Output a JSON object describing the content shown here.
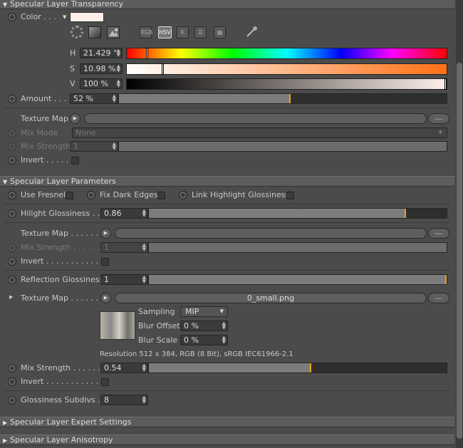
{
  "sections": {
    "transparency": "Specular Layer Transparency",
    "parameters": "Specular Layer Parameters",
    "expert": "Specular Layer Expert Settings",
    "anisotropy": "Specular Layer Anisotropy"
  },
  "transparency": {
    "color_label": "Color . . .",
    "color_swatch": "#fff0ea",
    "mode_buttons": [
      "RGB",
      "HSV",
      "K"
    ],
    "h_label": "H",
    "h_value": "21.429 °",
    "s_label": "S",
    "s_value": "10.98 %",
    "v_label": "V",
    "v_value": "100 %",
    "amount_label": "Amount . . . .",
    "amount_value": "52 %",
    "amount_fraction": 0.52,
    "texture_map_label": "Texture Map",
    "more_button": "...",
    "mix_mode_label": "Mix Mode . .",
    "mix_mode_value": "None",
    "mix_strength_label": "Mix Strength",
    "mix_strength_value": "1",
    "invert_label": "Invert . . . . . ."
  },
  "parameters": {
    "use_fresnel": "Use Fresnel",
    "fix_dark_edges": "Fix Dark Edges",
    "link_highlight": "Link Highlight Glossiness",
    "hilight_label": "Hilight Glossiness . . .",
    "hilight_value": "0.86",
    "hilight_fraction": 0.86,
    "texture_map_label": "Texture Map . . . . . . .",
    "mix_strength_label": "Mix Strength . . . . . . .",
    "mix_strength_value": "1",
    "invert_label": "Invert . . . . . . . . . . . .",
    "refl_label": "Reflection Glossiness",
    "refl_value": "1",
    "refl_fraction": 1.0,
    "texture_map2_label": "Texture Map . . . . . . .",
    "texture_file": "0_small.png",
    "sampling_label": "Sampling",
    "sampling_value": "MIP",
    "blur_offset_label": "Blur Offset",
    "blur_offset_value": "0 %",
    "blur_scale_label": "Blur Scale",
    "blur_scale_value": "0 %",
    "resolution": "Resolution 512 x 384, RGB (8 Bit), sRGB IEC61966-2.1",
    "mix_strength2_label": "Mix Strength . . . . . . .",
    "mix_strength2_value": "0.54",
    "mix_strength2_fraction": 0.54,
    "invert2_label": "Invert . . . . . . . . . . . .",
    "subdivs_label": "Glossiness Subdivs . .",
    "subdivs_value": "8"
  }
}
